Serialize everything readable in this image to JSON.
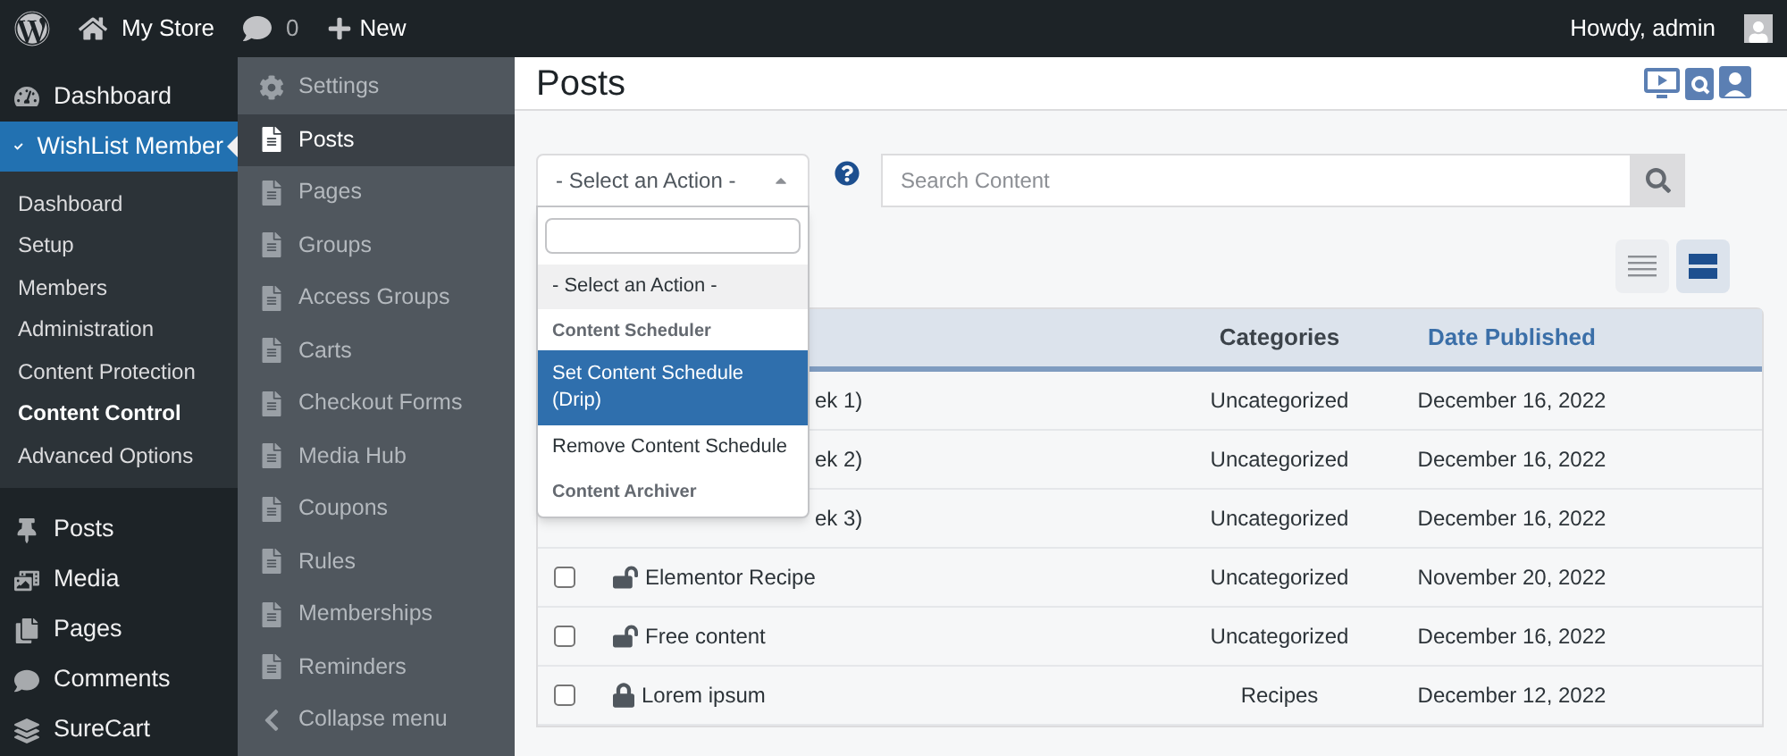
{
  "admin_bar": {
    "site": "My Store",
    "comments": "0",
    "new": "New",
    "greeting": "Howdy, admin"
  },
  "sidebar": {
    "items": [
      {
        "label": "Dashboard",
        "selected": false
      },
      {
        "label": "WishList Member",
        "selected": true,
        "children": [
          {
            "label": "Dashboard",
            "selected": false
          },
          {
            "label": "Setup",
            "selected": false
          },
          {
            "label": "Members",
            "selected": false
          },
          {
            "label": "Administration",
            "selected": false
          },
          {
            "label": "Content Protection",
            "selected": false
          },
          {
            "label": "Content Control",
            "selected": true
          },
          {
            "label": "Advanced Options",
            "selected": false
          }
        ]
      },
      {
        "label": "Posts",
        "selected": false
      },
      {
        "label": "Media",
        "selected": false
      },
      {
        "label": "Pages",
        "selected": false
      },
      {
        "label": "Comments",
        "selected": false
      },
      {
        "label": "SureCart",
        "selected": false
      }
    ]
  },
  "flyout": {
    "items": [
      {
        "label": "Settings",
        "selected": false
      },
      {
        "label": "Posts",
        "selected": true
      },
      {
        "label": "Pages",
        "selected": false
      },
      {
        "label": "Groups",
        "selected": false
      },
      {
        "label": "Access Groups",
        "selected": false
      },
      {
        "label": "Carts",
        "selected": false
      },
      {
        "label": "Checkout Forms",
        "selected": false
      },
      {
        "label": "Media Hub",
        "selected": false
      },
      {
        "label": "Coupons",
        "selected": false
      },
      {
        "label": "Rules",
        "selected": false
      },
      {
        "label": "Memberships",
        "selected": false
      },
      {
        "label": "Reminders",
        "selected": false
      },
      {
        "label": "Collapse menu",
        "selected": false
      }
    ]
  },
  "page": {
    "title": "Posts"
  },
  "action_select": {
    "value": "- Select an Action -",
    "expanded": true,
    "options": [
      {
        "kind": "option",
        "label": "- Select an Action -",
        "selected": true,
        "highlighted": false
      },
      {
        "kind": "group",
        "label": "Content Scheduler"
      },
      {
        "kind": "option",
        "label": "Set Content Schedule (Drip)",
        "selected": false,
        "highlighted": true
      },
      {
        "kind": "option",
        "label": "Remove Content Schedule",
        "selected": false,
        "highlighted": false
      },
      {
        "kind": "group",
        "label": "Content Archiver"
      }
    ]
  },
  "search": {
    "placeholder": "Search Content"
  },
  "view_toggle": [
    {
      "kind": "list",
      "selected": false
    },
    {
      "kind": "blocks",
      "selected": true
    }
  ],
  "table": {
    "columns": [
      {
        "label": "Categories",
        "sorted": false
      },
      {
        "label": "Date Published",
        "sorted": true
      }
    ],
    "rows": [
      {
        "title": "ek 1)",
        "category": "Uncategorized",
        "date": "December 16, 2022"
      },
      {
        "title": "ek 2)",
        "category": "Uncategorized",
        "date": "December 16, 2022"
      },
      {
        "title": "ek 3)",
        "category": "Uncategorized",
        "date": "December 16, 2022"
      },
      {
        "title": "Elementor Recipe",
        "checked": false,
        "locked": false,
        "category": "Uncategorized",
        "date": "November 20, 2022"
      },
      {
        "title": "Free content",
        "checked": false,
        "locked": false,
        "category": "Uncategorized",
        "date": "December 16, 2022"
      },
      {
        "title": "Lorem ipsum",
        "checked": false,
        "locked": true,
        "category": "Recipes",
        "date": "December 12, 2022"
      }
    ]
  }
}
